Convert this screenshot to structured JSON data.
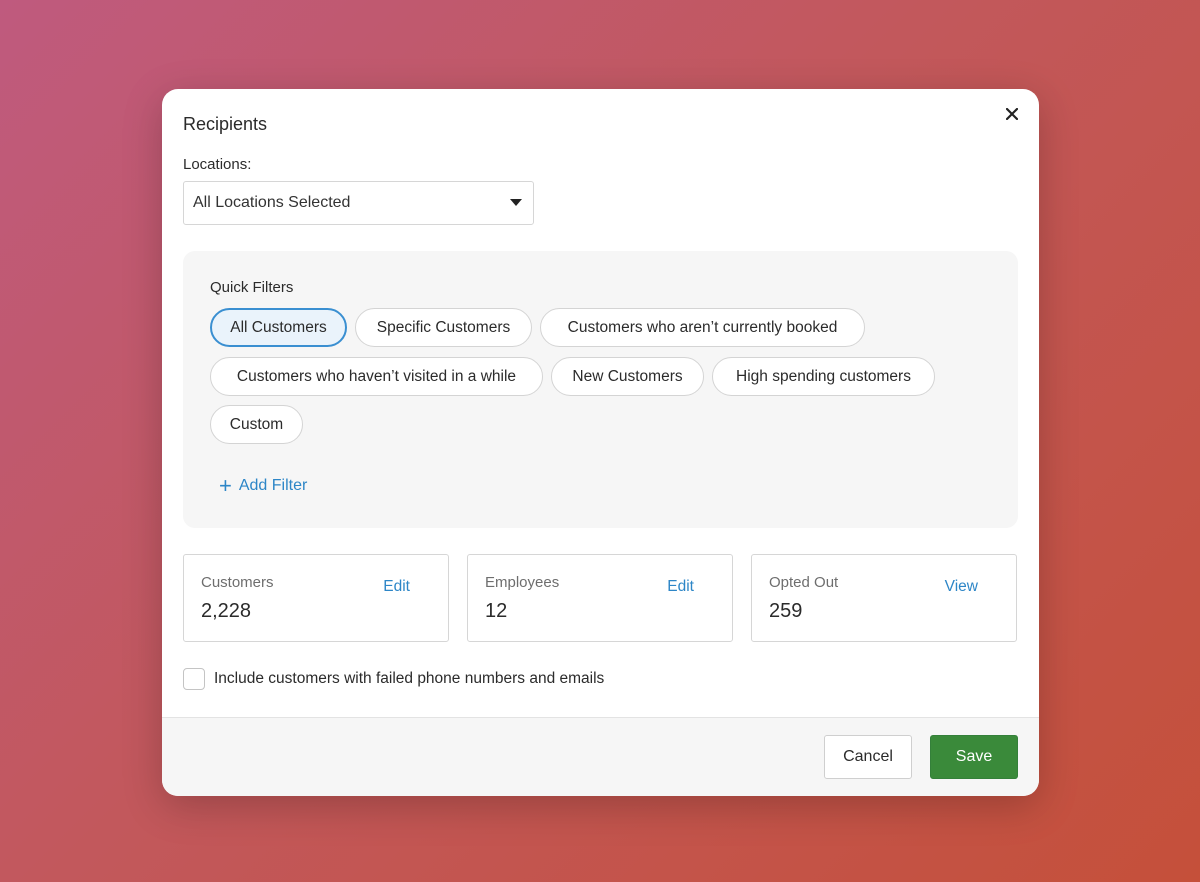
{
  "modal": {
    "title": "Recipients",
    "close_icon": "close-icon"
  },
  "locations": {
    "label": "Locations:",
    "selected": "All Locations Selected"
  },
  "quick_filters": {
    "title": "Quick Filters",
    "chips": [
      {
        "label": "All Customers",
        "active": true
      },
      {
        "label": "Specific Customers",
        "active": false
      },
      {
        "label": "Customers who aren’t currently booked",
        "active": false
      },
      {
        "label": "Customers who haven’t visited in a while",
        "active": false
      },
      {
        "label": "New Customers",
        "active": false
      },
      {
        "label": "High spending customers",
        "active": false
      },
      {
        "label": "Custom",
        "active": false
      }
    ],
    "add_filter_label": "Add Filter"
  },
  "stats": [
    {
      "label": "Customers",
      "value": "2,228",
      "link": "Edit"
    },
    {
      "label": "Employees",
      "value": "12",
      "link": "Edit"
    },
    {
      "label": "Opted Out",
      "value": "259",
      "link": "View"
    }
  ],
  "include_failed": {
    "label": "Include customers with failed phone numbers and emails",
    "checked": false
  },
  "footer": {
    "cancel_label": "Cancel",
    "save_label": "Save"
  },
  "colors": {
    "accent": "#2d86c7",
    "save_green": "#3a8a3a",
    "active_chip_border": "#3a8fd1"
  }
}
